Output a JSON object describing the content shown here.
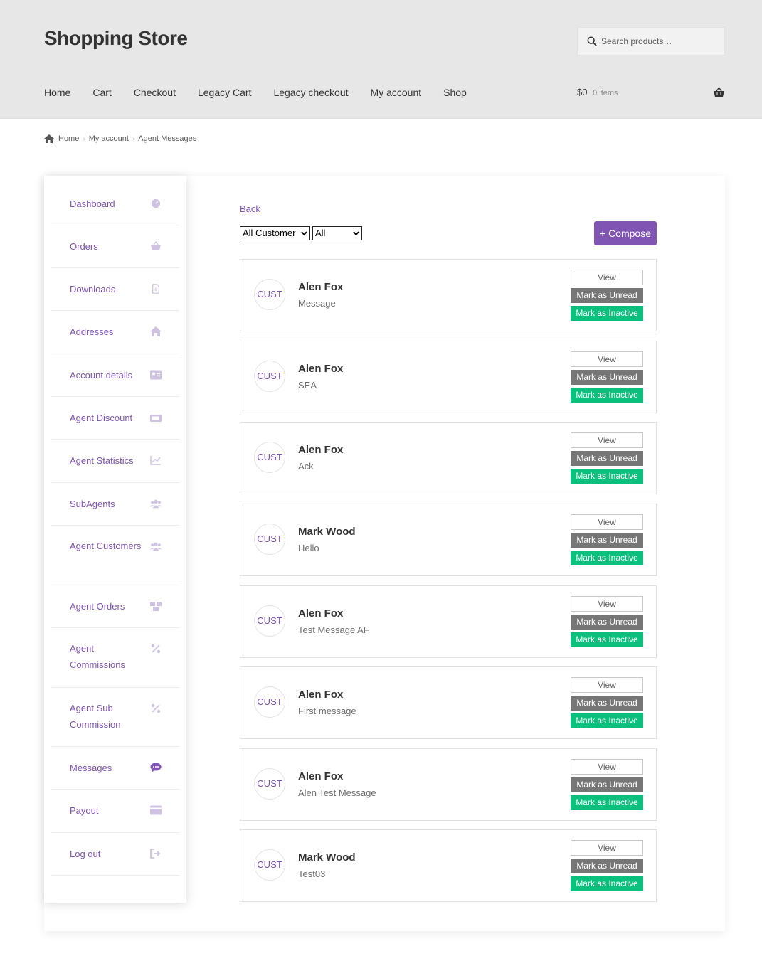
{
  "header": {
    "site_title": "Shopping Store",
    "search_placeholder": "Search products…",
    "nav": [
      "Home",
      "Cart",
      "Checkout",
      "Legacy Cart",
      "Legacy checkout",
      "My account",
      "Shop"
    ],
    "cart_total": "$0",
    "cart_count": "0 items"
  },
  "breadcrumb": {
    "home": "Home",
    "parent": "My account",
    "current": "Agent Messages"
  },
  "sidebar": {
    "items": [
      {
        "label": "Dashboard",
        "icon": "dashboard-icon"
      },
      {
        "label": "Orders",
        "icon": "basket-icon"
      },
      {
        "label": "Downloads",
        "icon": "file-icon"
      },
      {
        "label": "Addresses",
        "icon": "home-icon"
      },
      {
        "label": "Account details",
        "icon": "id-card-icon"
      },
      {
        "label": "Agent Discount",
        "icon": "ticket-icon"
      },
      {
        "label": "Agent Statistics",
        "icon": "chart-line-icon"
      },
      {
        "label": "SubAgents",
        "icon": "users-icon"
      },
      {
        "label": "Agent Customers",
        "icon": "users-icon"
      },
      {
        "label": "Agent Orders",
        "icon": "boxes-icon"
      },
      {
        "label": "Agent Commissions",
        "icon": "percent-icon"
      },
      {
        "label": "Agent Sub Commission",
        "icon": "percent-icon"
      },
      {
        "label": "Messages",
        "icon": "comment-icon"
      },
      {
        "label": "Payout",
        "icon": "wallet-icon"
      },
      {
        "label": "Log out",
        "icon": "sign-out-icon"
      }
    ]
  },
  "content": {
    "back_label": "Back",
    "customer_filter": "All Customer",
    "status_filter": "All",
    "compose_label": "+ Compose",
    "avatar_text": "CUST",
    "view_label": "View",
    "unread_label": "Mark as Unread",
    "inactive_label": "Mark as Inactive",
    "messages": [
      {
        "name": "Alen Fox",
        "text": "Message"
      },
      {
        "name": "Alen Fox",
        "text": "SEA"
      },
      {
        "name": "Alen Fox",
        "text": "Ack"
      },
      {
        "name": "Mark Wood",
        "text": "Hello"
      },
      {
        "name": "Alen Fox",
        "text": "Test Message AF"
      },
      {
        "name": "Alen Fox",
        "text": "First message"
      },
      {
        "name": "Alen Fox",
        "text": "Alen Test Message"
      },
      {
        "name": "Mark Wood",
        "text": "Test03"
      }
    ]
  },
  "colors": {
    "accent": "#7f54b3",
    "unread": "#767676",
    "inactive": "#0bbf7d",
    "header_bg": "#e7e7e7"
  }
}
